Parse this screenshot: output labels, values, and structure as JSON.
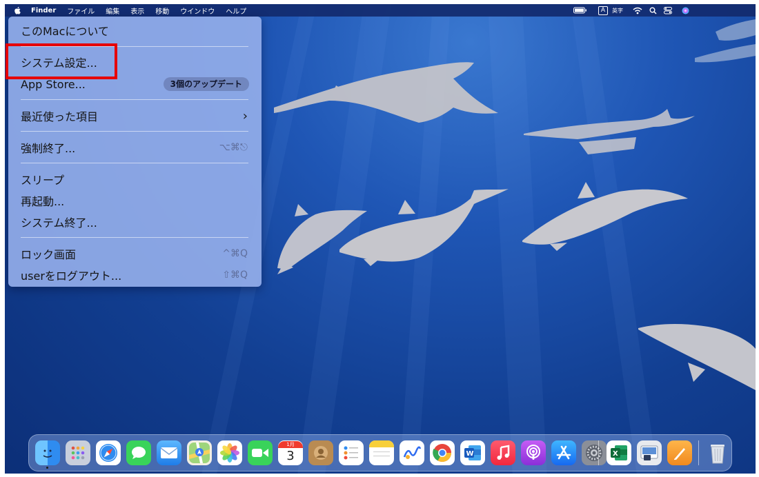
{
  "menubar": {
    "app_name": "Finder",
    "items": [
      "ファイル",
      "編集",
      "表示",
      "移動",
      "ウインドウ",
      "ヘルプ"
    ],
    "input_mode_letter": "A",
    "input_mode_label": "英字"
  },
  "apple_menu": {
    "about": "このMacについて",
    "system_settings": "システム設定...",
    "app_store": "App Store...",
    "app_store_badge": "3個のアップデート",
    "recent_items": "最近使った項目",
    "force_quit": "強制終了...",
    "force_quit_shortcut": "⌥⌘⎋",
    "sleep": "スリープ",
    "restart": "再起動...",
    "shutdown": "システム終了...",
    "lock_screen": "ロック画面",
    "lock_screen_shortcut": "^⌘Q",
    "logout": "userをログアウト...",
    "logout_shortcut": "⇧⌘Q"
  },
  "dock": {
    "calendar_month": "1月",
    "calendar_day": "3",
    "apps": [
      "finder-icon",
      "launchpad-icon",
      "safari-icon",
      "messages-icon",
      "mail-icon",
      "maps-icon",
      "photos-icon",
      "facetime-icon",
      "calendar-icon",
      "contacts-icon",
      "reminders-icon",
      "notes-icon",
      "freeform-icon",
      "chrome-icon",
      "word-icon",
      "music-icon",
      "podcasts-icon",
      "app-store-icon",
      "system-settings-icon",
      "excel-icon",
      "preview-icon",
      "pages-icon",
      "trash-icon"
    ]
  },
  "colors": {
    "highlight": "#e60000",
    "menu_background": "#96afeb",
    "desktop_blue": "#1f56b5"
  }
}
